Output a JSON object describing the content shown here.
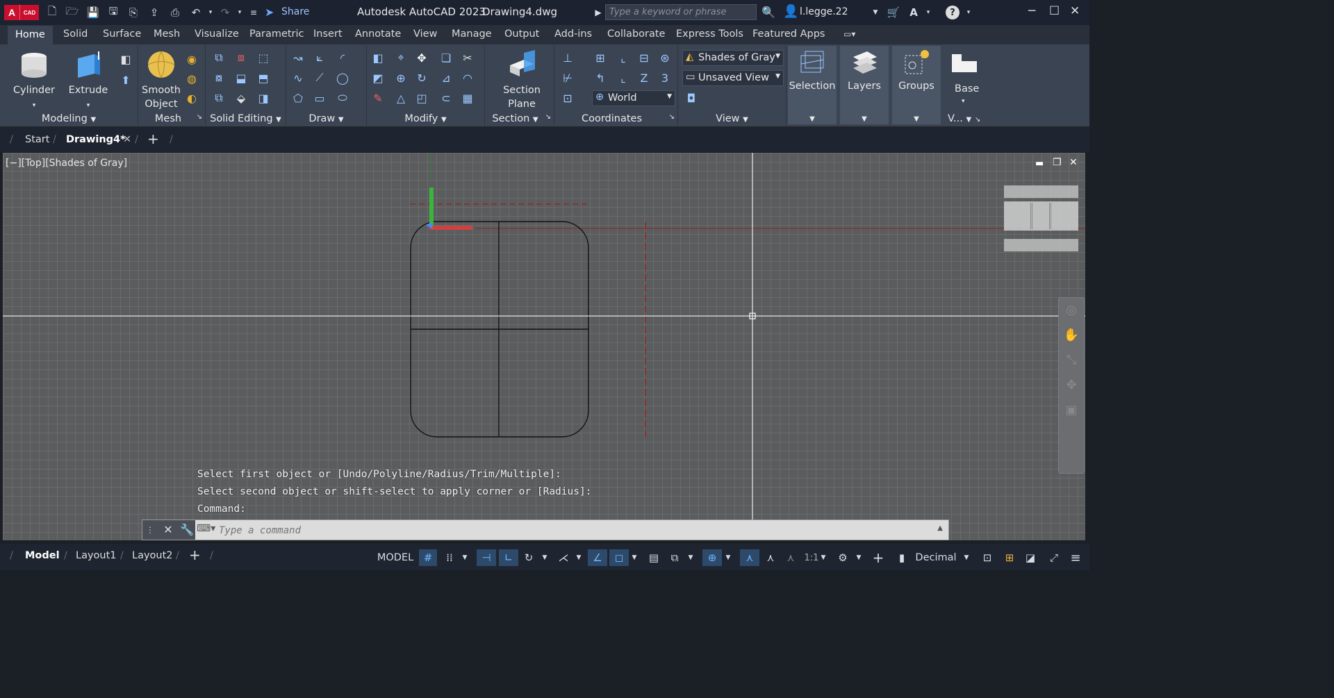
{
  "titlebar": {
    "app_logo_letter": "A",
    "app_logo_tag": "CAD",
    "share": "Share",
    "app_title": "Autodesk AutoCAD 2023",
    "document": "Drawing4.dwg",
    "search_placeholder": "Type a keyword or phrase",
    "user": "l.legge.22"
  },
  "menu_tabs": [
    "Home",
    "Solid",
    "Surface",
    "Mesh",
    "Visualize",
    "Parametric",
    "Insert",
    "Annotate",
    "View",
    "Manage",
    "Output",
    "Add-ins",
    "Collaborate",
    "Express Tools",
    "Featured Apps"
  ],
  "ribbon": {
    "modeling": {
      "label": "Modeling",
      "cylinder": "Cylinder",
      "extrude": "Extrude"
    },
    "mesh": {
      "label": "Mesh",
      "smooth_object_line1": "Smooth",
      "smooth_object_line2": "Object"
    },
    "solid_editing": {
      "label": "Solid Editing"
    },
    "draw": {
      "label": "Draw"
    },
    "modify": {
      "label": "Modify"
    },
    "section": {
      "label": "Section",
      "plane_line1": "Section",
      "plane_line2": "Plane"
    },
    "coordinates": {
      "label": "Coordinates",
      "ucs": "World"
    },
    "view": {
      "label": "View",
      "visual_style": "Shades of Gray",
      "named_view": "Unsaved View"
    },
    "selection": "Selection",
    "layers": "Layers",
    "groups": "Groups",
    "base": "Base",
    "v_label": "V..."
  },
  "file_tabs": {
    "start": "Start",
    "drawing": "Drawing4*"
  },
  "viewport": {
    "label": "[−][Top][Shades of Gray]"
  },
  "command_history": [
    "Select first object or [Undo/Polyline/Radius/Trim/Multiple]:",
    "Select second object or shift-select to apply corner or [Radius]:",
    "Command:"
  ],
  "command_line": {
    "placeholder": "Type a command"
  },
  "layout_tabs": [
    "Model",
    "Layout1",
    "Layout2"
  ],
  "status": {
    "model": "MODEL",
    "scale": "1:1",
    "units": "Decimal"
  }
}
